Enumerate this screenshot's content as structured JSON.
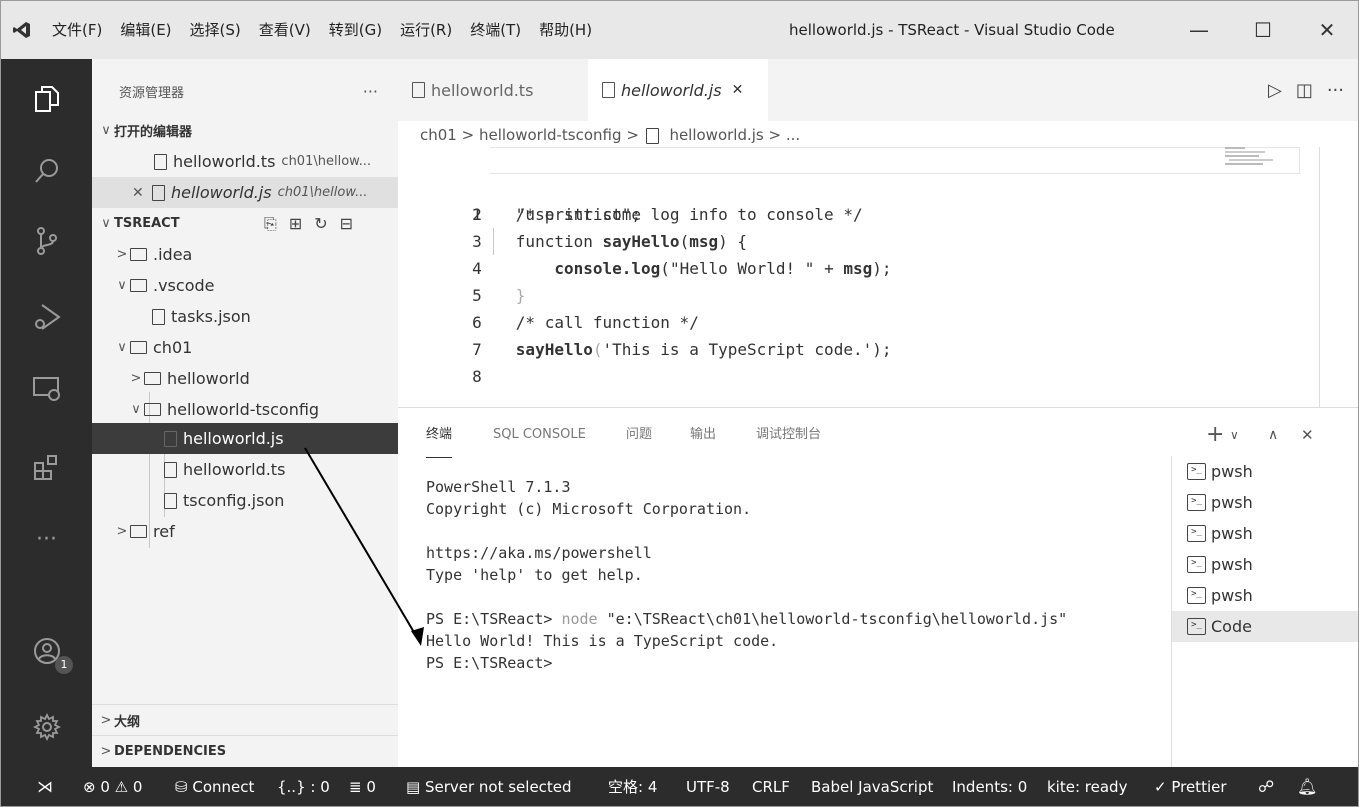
{
  "titlebar": {
    "menu": [
      "文件(F)",
      "编辑(E)",
      "选择(S)",
      "查看(V)",
      "转到(G)",
      "运行(R)",
      "终端(T)",
      "帮助(H)"
    ],
    "title": "helloworld.js - TSReact - Visual Studio Code",
    "minimize": "—",
    "maximize": "☐",
    "close": "✕"
  },
  "activity": {
    "icons": [
      "explorer-icon",
      "search-icon",
      "source-control-icon",
      "run-debug-icon",
      "remote-explorer-icon",
      "extensions-icon",
      "more-icon",
      "accounts-icon",
      "settings-gear-icon"
    ],
    "accounts_badge": "1"
  },
  "sidebar": {
    "header": "资源管理器",
    "more": "···",
    "open_editors_label": "打开的编辑器",
    "open_editors": [
      {
        "close": "",
        "name": "helloworld.ts",
        "path": "ch01\\hellow..."
      },
      {
        "close": "✕",
        "name": "helloworld.js",
        "path": "ch01\\hellow..."
      }
    ],
    "project_label": "TSREACT",
    "tree": [
      {
        "chev": ">",
        "type": "folder",
        "name": ".idea"
      },
      {
        "chev": "∨",
        "type": "folder",
        "name": ".vscode"
      },
      {
        "chev": "",
        "type": "file",
        "name": "tasks.json"
      },
      {
        "chev": "∨",
        "type": "folder",
        "name": "ch01"
      },
      {
        "chev": ">",
        "type": "folder",
        "name": "helloworld"
      },
      {
        "chev": "∨",
        "type": "folder",
        "name": "helloworld-tsconfig"
      },
      {
        "chev": "",
        "type": "file",
        "name": "helloworld.js"
      },
      {
        "chev": "",
        "type": "file",
        "name": "helloworld.ts"
      },
      {
        "chev": "",
        "type": "file",
        "name": "tsconfig.json"
      },
      {
        "chev": ">",
        "type": "folder",
        "name": "ref"
      }
    ],
    "outline_label": "大纲",
    "deps_label": "DEPENDENCIES"
  },
  "editor": {
    "tabs": [
      {
        "name": "helloworld.ts",
        "active": false
      },
      {
        "name": "helloworld.js",
        "active": true,
        "close": "✕"
      }
    ],
    "breadcrumb": {
      "a": "ch01",
      "b": "helloworld-tsconfig",
      "c": "helloworld.js",
      "d": "..."
    },
    "line_numbers": [
      "1",
      "2",
      "3",
      "4",
      "5",
      "6",
      "7",
      "8"
    ],
    "lines": {
      "l1": "\"use strict\";",
      "l2": "/* print some log info to console */",
      "l3a": "function ",
      "l3b": "sayHello",
      "l3c": "(",
      "l3d": "msg",
      "l3e": ") {",
      "l4a": "    console.log",
      "l4b": "(",
      "l4c": "\"Hello World! \"",
      "l4d": " + ",
      "l4e": "msg",
      "l4f": ");",
      "l5": "}",
      "l6": "/* call function */",
      "l7a": "sayHello",
      "l7b": "(",
      "l7c": "'This is a TypeScript code.'",
      "l7d": ");",
      "l8": ""
    }
  },
  "panel": {
    "tabs": [
      "终端",
      "SQL CONSOLE",
      "问题",
      "输出",
      "调试控制台"
    ],
    "actions": {
      "add": "+",
      "dropdown": "∨",
      "maximize": "∧",
      "close": "✕"
    },
    "terminal_lines": [
      "PowerShell 7.1.3",
      "Copyright (c) Microsoft Corporation.",
      "",
      "https://aka.ms/powershell",
      "Type 'help' to get help.",
      "",
      "PS E:\\TSReact> node \"e:\\TSReact\\ch01\\helloworld-tsconfig\\helloworld.js\"",
      "Hello World! This is a TypeScript code.",
      "PS E:\\TSReact>"
    ],
    "terminal_prompt": "PS E:\\TSReact> ",
    "terminal_cmd": "node",
    "terminal_arg": " \"e:\\TSReact\\ch01\\helloworld-tsconfig\\helloworld.js\"",
    "terminals": [
      "pwsh",
      "pwsh",
      "pwsh",
      "pwsh",
      "pwsh",
      "Code"
    ]
  },
  "status": {
    "remote": "⋊",
    "problems": "⊗ 0 ⚠ 0",
    "connect": "Connect",
    "braces": "{..} : 0",
    "list": "≣ 0",
    "server": "Server not selected",
    "spaces": "空格: 4",
    "encoding": "UTF-8",
    "eol": "CRLF",
    "language": "Babel JavaScript",
    "indents": "Indents: 0",
    "kite": "kite: ready",
    "prettier": "✓ Prettier"
  }
}
